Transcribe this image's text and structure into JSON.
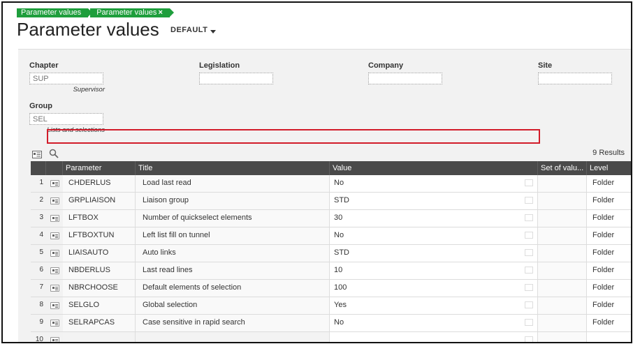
{
  "breadcrumbs": [
    {
      "label": "Parameter values"
    },
    {
      "label": "Parameter values",
      "close": "×"
    }
  ],
  "page_title": "Parameter values",
  "variant": "DEFAULT",
  "criteria": {
    "chapter": {
      "label": "Chapter",
      "value": "SUP",
      "description": "Supervisor"
    },
    "legislation": {
      "label": "Legislation",
      "value": ""
    },
    "company": {
      "label": "Company",
      "value": ""
    },
    "site": {
      "label": "Site",
      "value": ""
    },
    "group": {
      "label": "Group",
      "value": "SEL",
      "description": "Lists and selections"
    }
  },
  "results_text": "9 Results",
  "table": {
    "headers": [
      "Parameter",
      "Title",
      "Value",
      "Set of valu...",
      "Level"
    ],
    "rows": [
      {
        "num": "1",
        "parameter": "CHDERLUS",
        "title": "Load last read",
        "value": "No",
        "set": "",
        "level": "Folder"
      },
      {
        "num": "2",
        "parameter": "GRPLIAISON",
        "title": "Liaison group",
        "value": "STD",
        "set": "",
        "level": "Folder"
      },
      {
        "num": "3",
        "parameter": "LFTBOX",
        "title": "Number of quickselect elements",
        "value": "30",
        "set": "",
        "level": "Folder"
      },
      {
        "num": "4",
        "parameter": "LFTBOXTUN",
        "title": "Left list fill on tunnel",
        "value": "No",
        "set": "",
        "level": "Folder"
      },
      {
        "num": "5",
        "parameter": "LIAISAUTO",
        "title": "Auto links",
        "value": "STD",
        "set": "",
        "level": "Folder"
      },
      {
        "num": "6",
        "parameter": "NBDERLUS",
        "title": "Last read lines",
        "value": "10",
        "set": "",
        "level": "Folder"
      },
      {
        "num": "7",
        "parameter": "NBRCHOOSE",
        "title": "Default elements of selection",
        "value": "100",
        "set": "",
        "level": "Folder"
      },
      {
        "num": "8",
        "parameter": "SELGLO",
        "title": "Global selection",
        "value": "Yes",
        "set": "",
        "level": "Folder"
      },
      {
        "num": "9",
        "parameter": "SELRAPCAS",
        "title": "Case sensitive in rapid search",
        "value": "No",
        "set": "",
        "level": "Folder"
      },
      {
        "num": "10",
        "parameter": "",
        "title": "",
        "value": "",
        "set": "",
        "level": ""
      }
    ]
  },
  "colors": {
    "breadcrumb": "#1e9e3c",
    "header": "#4a4a4a",
    "highlight": "#d21c2a"
  },
  "icons": [
    "table-view-icon",
    "search-icon",
    "row-detail-icon",
    "value-selector-icon"
  ]
}
